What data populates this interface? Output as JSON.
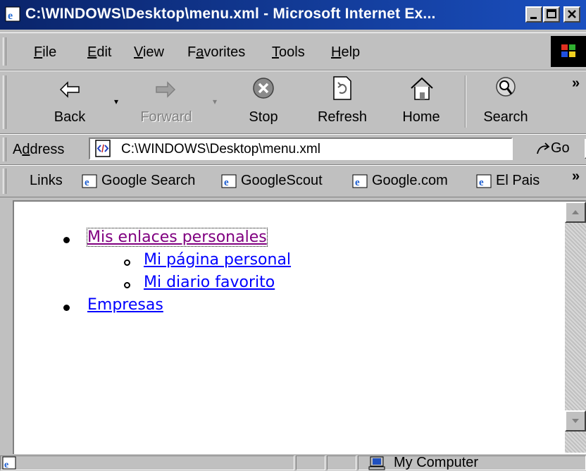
{
  "window": {
    "title": "C:\\WINDOWS\\Desktop\\menu.xml - Microsoft Internet Ex..."
  },
  "menubar": {
    "items": [
      {
        "pre": "",
        "key": "F",
        "post": "ile"
      },
      {
        "pre": "",
        "key": "E",
        "post": "dit"
      },
      {
        "pre": "",
        "key": "V",
        "post": "iew"
      },
      {
        "pre": "F",
        "key": "a",
        "post": "vorites"
      },
      {
        "pre": "",
        "key": "T",
        "post": "ools"
      },
      {
        "pre": "",
        "key": "H",
        "post": "elp"
      }
    ]
  },
  "toolbar": {
    "back_label": "Back",
    "forward_label": "Forward",
    "stop_label": "Stop",
    "refresh_label": "Refresh",
    "home_label": "Home",
    "search_label": "Search",
    "chevron": "»"
  },
  "address": {
    "label_pre": "A",
    "label_key": "d",
    "label_post": "dress",
    "value": "C:\\WINDOWS\\Desktop\\menu.xml",
    "go_label": "Go"
  },
  "links": {
    "label": "Links",
    "items": [
      "Google Search",
      "GoogleScout",
      "Google.com",
      "El Pais"
    ],
    "chevron": "»"
  },
  "content": {
    "items": [
      {
        "text": "Mis enlaces personales",
        "visited": true,
        "children": [
          "Mi página personal",
          "Mi diario favorito"
        ]
      },
      {
        "text": "Empresas",
        "visited": false
      }
    ]
  },
  "status": {
    "zone": "My Computer"
  },
  "colors": {
    "title_bar": "#0a246a",
    "link": "#0000ff",
    "visited_link": "#800080",
    "chrome": "#c0c0c0"
  }
}
